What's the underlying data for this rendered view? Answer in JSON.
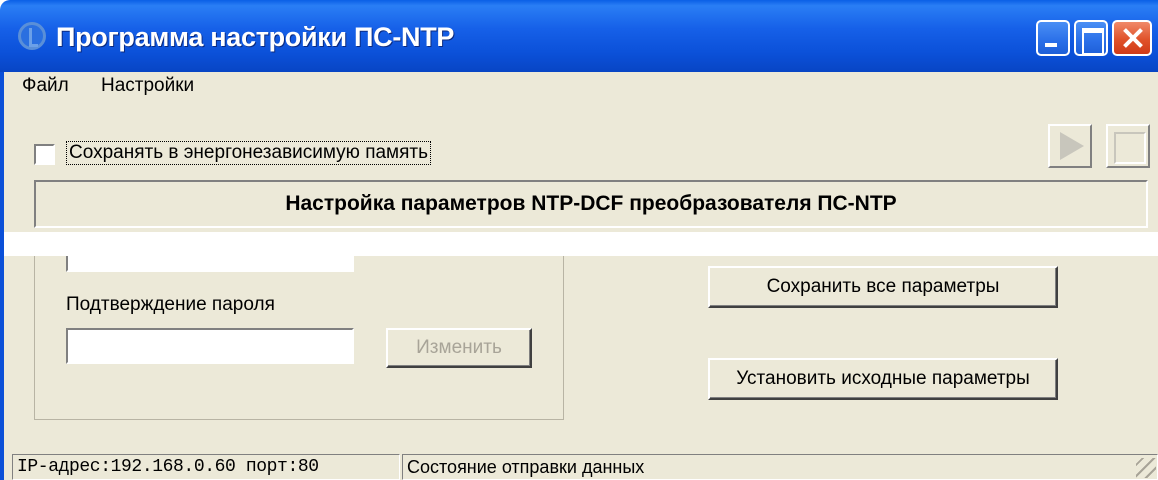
{
  "window": {
    "title": "Программа настройки ПС-NTP",
    "accent_color": "#0b50d8",
    "close_color": "#d03a18",
    "controls": [
      "minimize-icon",
      "maximize-icon",
      "close-icon"
    ]
  },
  "menu": {
    "items": [
      "Файл",
      "Настройки"
    ]
  },
  "toolbar": {
    "save_nvram_label": "Сохранять в энергонезависимую память",
    "save_nvram_checked": false,
    "play_icon": "play-icon",
    "stop_icon": "stop-icon"
  },
  "header": {
    "title": "Настройка параметров NTP-DCF преобразователя ПС-NTP"
  },
  "password": {
    "confirm_label": "Подтверждение пароля",
    "change_button": "Изменить"
  },
  "actions": {
    "save_all": "Сохранить все параметры",
    "restore_defaults": "Установить исходные параметры"
  },
  "status": {
    "ip_port": "IP-адрес:192.168.0.60 порт:80",
    "send_state": "Состояние отправки данных"
  }
}
